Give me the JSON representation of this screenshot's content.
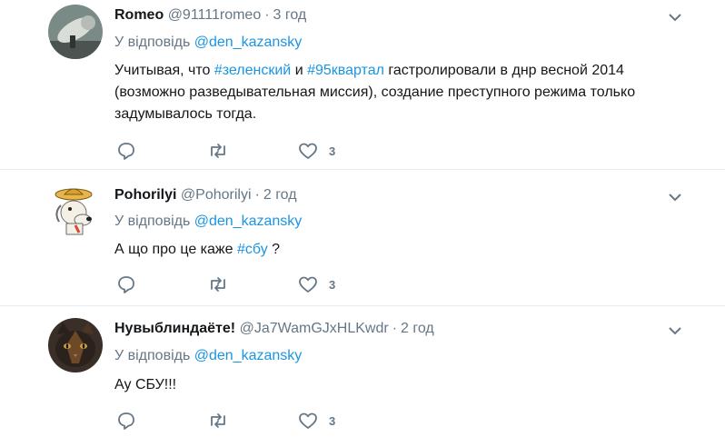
{
  "reply_prefix": "У відповідь",
  "tweets": [
    {
      "name": "Romeo",
      "handle": "@91111romeo",
      "time": "3 год",
      "mention": "@den_kazansky",
      "text_parts": [
        "Учитывая, что ",
        "#зеленский",
        " и ",
        "#95квартал",
        " гастролировали в днр весной 2014",
        "(возможно разведывательная миссия), создание преступного режима только",
        "задумывалось тогда."
      ],
      "likes": "3",
      "avatar_icon": "telescope-photo"
    },
    {
      "name": "Pohorilyi",
      "handle": "@Pohorilyi",
      "time": "2 год",
      "mention": "@den_kazansky",
      "text_parts": [
        "А що про це каже ",
        "#сбу",
        " ?"
      ],
      "likes": "3",
      "avatar_icon": "cartoon-dog-hat"
    },
    {
      "name": "Нувыблиндаёте!",
      "handle": "@Ja7WamGJxHLKwdr",
      "time": "2 год",
      "mention": "@den_kazansky",
      "text_parts": [
        "Ау СБУ!!!"
      ],
      "likes": "3",
      "avatar_icon": "cat-photo"
    }
  ],
  "colors": {
    "link": "#1b95e0",
    "secondary": "#657786",
    "border": "#e6ecf0"
  }
}
